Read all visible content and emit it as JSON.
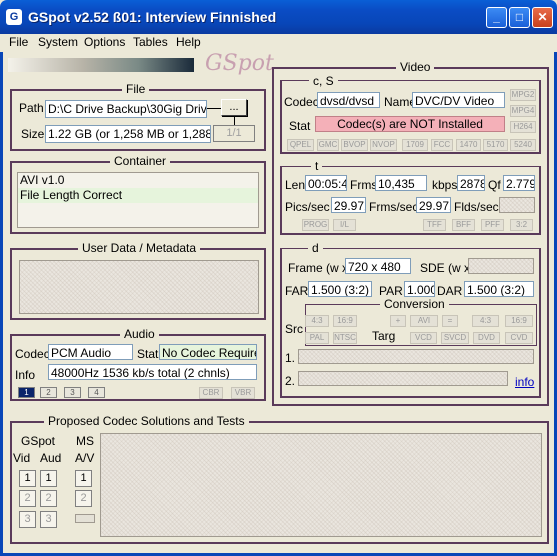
{
  "window": {
    "title": "GSpot v2.52 ß01: Interview Finnished",
    "app_icon": "G",
    "minimize": "_",
    "maximize": "□",
    "close": "✕"
  },
  "menu": [
    "File",
    "System",
    "Options",
    "Tables",
    "Help"
  ],
  "logo": "GSpot",
  "file": {
    "title": "File",
    "path_label": "Path",
    "path_value": "D:\\C Drive Backup\\30Gig Drive\\",
    "browse": "...",
    "size_label": "Size",
    "size_value": "1.22 GB (or 1,258 MB or 1,288,39",
    "page": "1/1"
  },
  "container": {
    "title": "Container",
    "lines": [
      "AVI v1.0",
      "File Length Correct"
    ]
  },
  "userdata": {
    "title": "User Data / Metadata"
  },
  "audio": {
    "title": "Audio",
    "codec_label": "Codec",
    "codec_value": "PCM Audio",
    "stat_label": "Stat",
    "stat_value": "No Codec Required",
    "info_label": "Info",
    "info_value": "48000Hz  1536 kb/s total (2 chnls)",
    "tabs": [
      "1",
      "2",
      "3",
      "4"
    ],
    "cbr": "CBR",
    "vbr": "VBR"
  },
  "video": {
    "title": "Video",
    "cs_label": "c, S",
    "codec_label": "Codec",
    "codec_value": "dvsd/dvsd",
    "name_label": "Name",
    "name_value": "DVC/DV Video",
    "stat_label": "Stat",
    "stat_value": "Codec(s) are NOT Installed",
    "side_chips": [
      "MPG2",
      "MPG4",
      "H264"
    ],
    "chips": [
      "QPEL",
      "GMC",
      "BVOP",
      "NVOP",
      "1709",
      "FCC",
      "1470",
      "5170",
      "5240"
    ],
    "t_label": "t",
    "len_label": "Len",
    "len_value": "00:05:4",
    "frms_label": "Frms",
    "frms_value": "10,435",
    "kbps_label": "kbps",
    "kbps_value": "2878",
    "qf_label": "Qf",
    "qf_value": "2.779",
    "pics_label": "Pics/sec",
    "pics_value": "29.971",
    "frmssec_label": "Frms/sec",
    "frmssec_value": "29.971",
    "flds_label": "Flds/sec",
    "t_chips_left": [
      "PROG",
      "I/L"
    ],
    "t_chips_right": [
      "TFF",
      "BFF",
      "PFF",
      "3:2"
    ],
    "d_label": "d",
    "frame_label": "Frame (w x",
    "frame_value": "720 x 480",
    "sde_label": "SDE (w x",
    "far_label": "FAR",
    "far_value": "1.500 (3:2)",
    "par_label": "PAR",
    "par_value": "1.000",
    "dar_label": "DAR",
    "dar_value": "1.500 (3:2)",
    "conversion_label": "Conversion",
    "src_label": "Src",
    "targ_label": "Targ",
    "src_chips": [
      "4:3",
      "16:9",
      "PAL",
      "NTSC"
    ],
    "targ_chips_top": [
      "+",
      "AVI",
      "=",
      "4:3",
      "16:9"
    ],
    "targ_chips_bottom": [
      "VCD",
      "SVCD",
      "DVD",
      "CVD"
    ],
    "row1_label": "1.",
    "row2_label": "2.",
    "info_link": "info"
  },
  "proposed": {
    "title": "Proposed Codec Solutions and Tests",
    "gspot_label": "GSpot",
    "ms_label": "MS",
    "vid_label": "Vid",
    "aud_label": "Aud",
    "av_label": "A/V",
    "buttons": [
      "1",
      "2",
      "3"
    ]
  }
}
